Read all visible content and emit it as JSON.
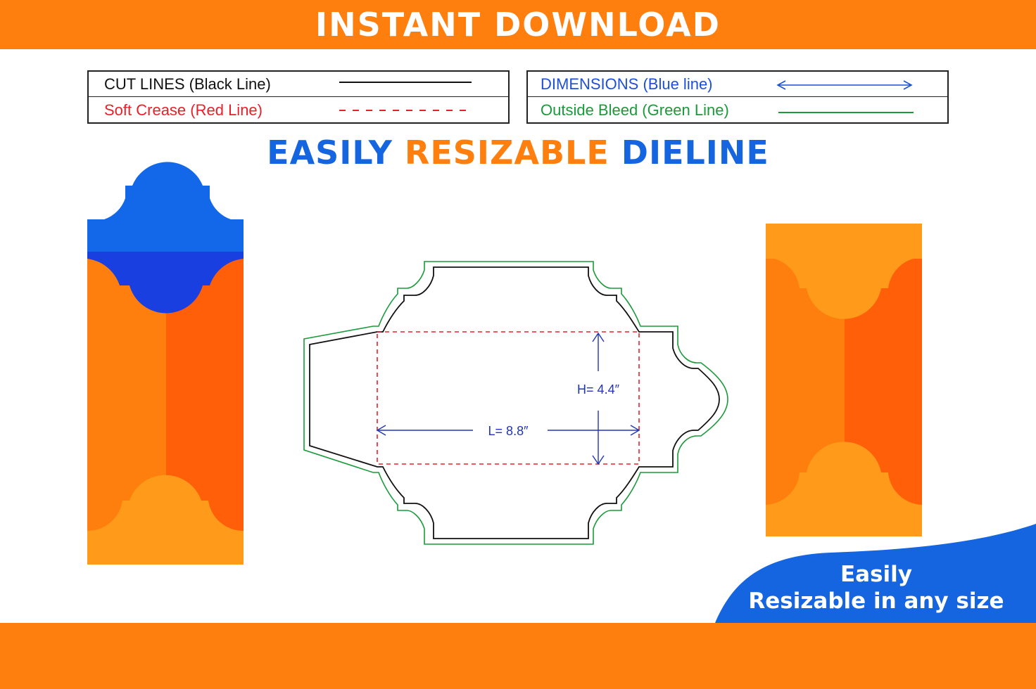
{
  "banner": {
    "title": "INSTANT DOWNLOAD"
  },
  "legend": {
    "left": [
      {
        "label": "CUT LINES (Black Line)",
        "color": "#111111",
        "style": "solid"
      },
      {
        "label": "Soft Crease (Red Line)",
        "color": "#e8202a",
        "style": "dashed"
      }
    ],
    "right": [
      {
        "label": "DIMENSIONS (Blue line)",
        "color": "#1e4fd8",
        "style": "double-arrow"
      },
      {
        "label": "Outside Bleed (Green Line)",
        "color": "#1a9a3a",
        "style": "solid"
      }
    ]
  },
  "headline": {
    "word1": "EASILY",
    "word2": "RESIZABLE",
    "word3": "DIELINE",
    "color1": "#1565e0",
    "color2": "#ff7f0e",
    "color3": "#1565e0"
  },
  "dieline": {
    "height_label": "H= 4.4″",
    "length_label": "L= 8.8″",
    "cut_color": "#111111",
    "crease_color": "#e8202a",
    "dimension_color": "#2235b8",
    "bleed_color": "#1a9a3a"
  },
  "badge": {
    "line1": "Easily",
    "line2": "Resizable in any size",
    "color": "#1565e0"
  },
  "colors": {
    "orange": "#ff7f0e",
    "dark_orange": "#ff5f08",
    "light_orange": "#ff9a1a",
    "blue": "#1268e8",
    "dark_blue": "#1a3fe0"
  }
}
